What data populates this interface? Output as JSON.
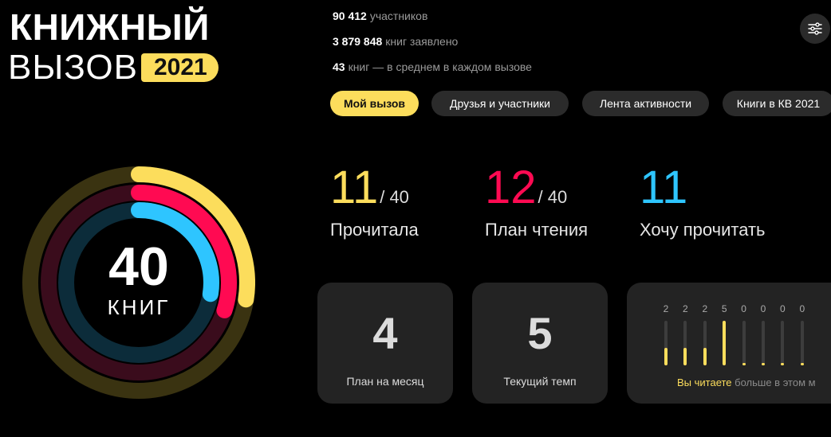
{
  "logo": {
    "line1": "КНИЖНЫЙ",
    "line2": "ВЫЗОВ",
    "year": "2021"
  },
  "stats": [
    {
      "value": "90 412",
      "label": "участников"
    },
    {
      "value": "3 879 848",
      "label": "книг заявлено"
    },
    {
      "value": "43",
      "label": "книг — в среднем в каждом вызове"
    }
  ],
  "settings": {
    "icon": "sliders-icon"
  },
  "tabs": [
    {
      "label": "Мой вызов",
      "active": true
    },
    {
      "label": "Друзья и участники",
      "active": false
    },
    {
      "label": "Лента активности",
      "active": false
    },
    {
      "label": "Книги в КВ 2021",
      "active": false
    }
  ],
  "ring": {
    "number": "40",
    "unit": "КНИГ",
    "goal": 40,
    "rings": [
      {
        "name": "read",
        "value": 11,
        "color": "#fcdd5c",
        "track": "#3a3311"
      },
      {
        "name": "plan",
        "value": 12,
        "color": "#ff0a52",
        "track": "#3a0c1c"
      },
      {
        "name": "want",
        "value": 11,
        "color": "#2ec5ff",
        "track": "#0c2c3a"
      }
    ]
  },
  "counters": [
    {
      "value": "11",
      "total": "/ 40",
      "label": "Прочитала",
      "color": "#fcdd5c"
    },
    {
      "value": "12",
      "total": "/ 40",
      "label": "План чтения",
      "color": "#ff0a52"
    },
    {
      "value": "11",
      "total": "",
      "label": "Хочу прочитать",
      "color": "#2ec5ff"
    }
  ],
  "cards": [
    {
      "value": "4",
      "label": "План на месяц"
    },
    {
      "value": "5",
      "label": "Текущий темп"
    }
  ],
  "monthly": {
    "values": [
      2,
      2,
      2,
      5,
      0,
      0,
      0,
      0
    ],
    "labels": [
      "2",
      "2",
      "2",
      "5",
      "0",
      "0",
      "0",
      "0"
    ],
    "max": 5,
    "note_highlight": "Вы читаете",
    "note_rest": " больше в этом м"
  },
  "colors": {
    "accent": "#fcdd5c",
    "background": "#000000",
    "card": "#232323"
  }
}
